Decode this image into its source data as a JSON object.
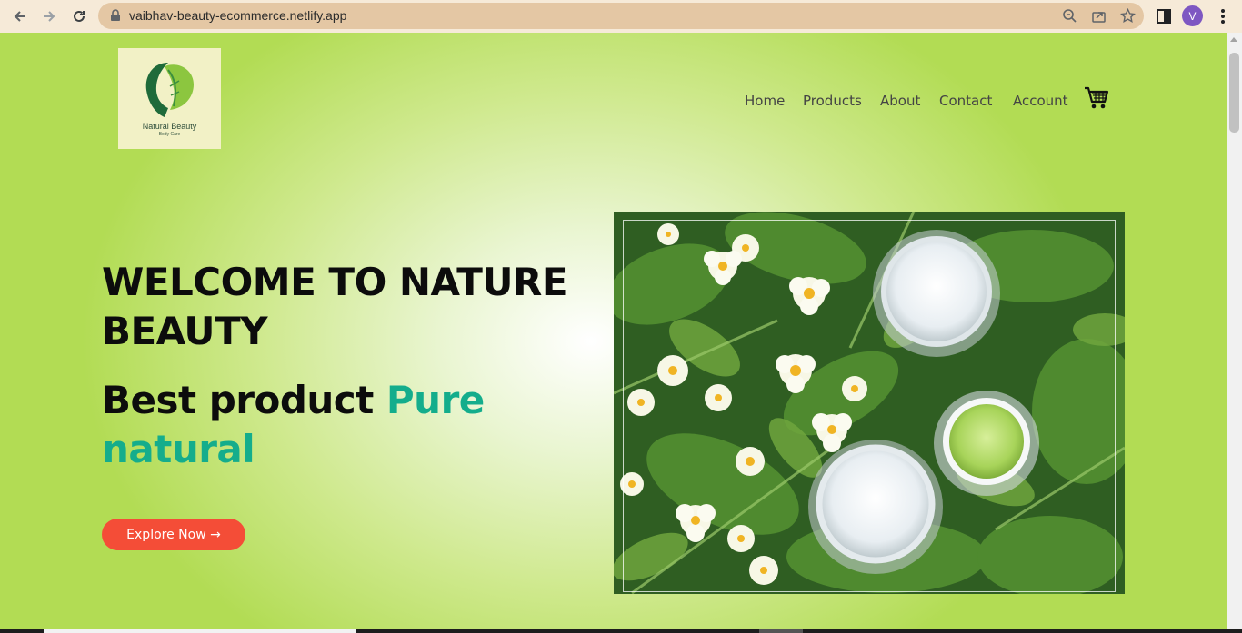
{
  "browser": {
    "url": "vaibhav-beauty-ecommerce.netlify.app",
    "profile_initial": "V"
  },
  "logo": {
    "brand_name": "Natural Beauty",
    "tagline": "Body Care"
  },
  "nav": {
    "items": [
      {
        "label": "Home"
      },
      {
        "label": "Products"
      },
      {
        "label": "About"
      },
      {
        "label": "Contact"
      },
      {
        "label": "Account"
      }
    ],
    "cart_icon": "shopping-cart-icon"
  },
  "hero": {
    "title": "WELCOME TO NATURE BEAUTY",
    "subtitle_main": "Best product ",
    "subtitle_accent": "Pure natural",
    "cta_label": "Explore Now →",
    "image_alt": "cosmetic jars among primrose flowers"
  },
  "colors": {
    "accent": "#14ad8c",
    "cta": "#f44d37",
    "background_light": "#ffffff",
    "background_green": "#b2dc54"
  }
}
